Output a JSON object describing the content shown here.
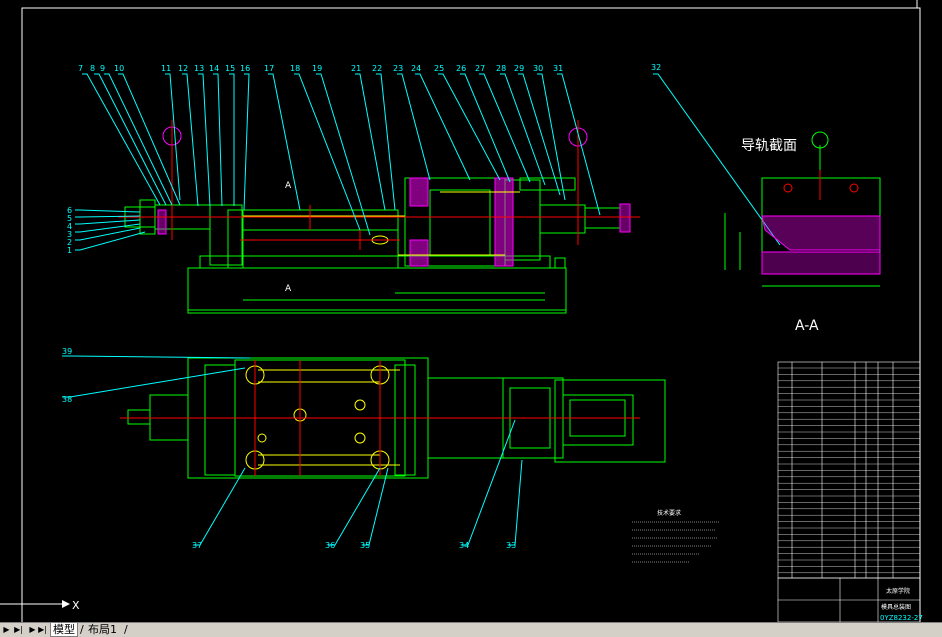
{
  "drawing": {
    "section_title": "导轨截面",
    "section_label": "A-A",
    "view_marker": "A",
    "part_numbers_top": [
      "7",
      "8",
      "9",
      "10",
      "11",
      "12",
      "13",
      "14",
      "15",
      "16",
      "17",
      "18",
      "19",
      "21",
      "22",
      "23",
      "24",
      "25",
      "26",
      "27",
      "28",
      "29",
      "30",
      "31"
    ],
    "part_numbers_left": [
      "6",
      "5",
      "4",
      "3",
      "2",
      "1"
    ],
    "part_number_32": "32",
    "part_numbers_plan": [
      "39",
      "38",
      "37",
      "36",
      "35",
      "34",
      "33"
    ],
    "tech_requirements_title": "技术要求",
    "title_block": {
      "school": "太原学院",
      "drawing_name": "模具总装图",
      "drawing_no": "0YZ8232-27"
    }
  },
  "ucs": {
    "x_label": "X"
  },
  "tabs": {
    "model": "模型",
    "layout1": "布局1",
    "separator": "/"
  },
  "colors": {
    "background": "#000000",
    "frame": "#ffffff",
    "outline": "#00ff00",
    "centerline": "#ff0000",
    "leader": "#00ffff",
    "hatch": "#ff00ff",
    "highlight": "#ffff00"
  }
}
